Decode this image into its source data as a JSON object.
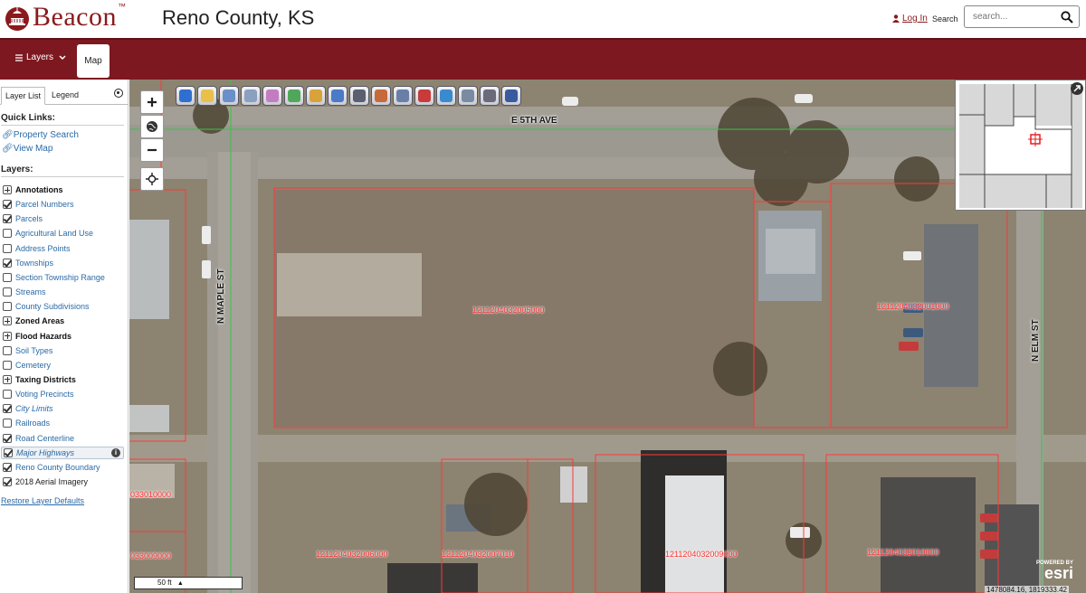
{
  "header": {
    "logo_text": "Beacon",
    "logo_tm": "™",
    "county": "Reno County, KS",
    "login_label": "Log In",
    "search_label": "Search",
    "search_placeholder": "search..."
  },
  "toolbar": {
    "layers_label": "Layers",
    "map_label": "Map"
  },
  "panel": {
    "tab_layer_list": "Layer List",
    "tab_legend": "Legend",
    "quick_links_heading": "Quick Links:",
    "quick_links": [
      "Property Search",
      "View Map"
    ],
    "layers_heading": "Layers:",
    "layers": [
      {
        "label": "Annotations",
        "state": "plus",
        "group": true
      },
      {
        "label": "Parcel Numbers",
        "state": "checked"
      },
      {
        "label": "Parcels",
        "state": "checked"
      },
      {
        "label": "Agricultural Land Use",
        "state": "unchecked"
      },
      {
        "label": "Address Points",
        "state": "unchecked"
      },
      {
        "label": "Townships",
        "state": "checked"
      },
      {
        "label": "Section Township Range",
        "state": "unchecked"
      },
      {
        "label": "Streams",
        "state": "unchecked"
      },
      {
        "label": "County Subdivisions",
        "state": "unchecked"
      },
      {
        "label": "Zoned Areas",
        "state": "plus",
        "group": true
      },
      {
        "label": "Flood Hazards",
        "state": "plus",
        "group": true
      },
      {
        "label": "Soil Types",
        "state": "unchecked"
      },
      {
        "label": "Cemetery",
        "state": "unchecked"
      },
      {
        "label": "Taxing Districts",
        "state": "plus",
        "group": true
      },
      {
        "label": "Voting Precincts",
        "state": "unchecked"
      },
      {
        "label": "City Limits",
        "state": "checked",
        "italic": true
      },
      {
        "label": "Railroads",
        "state": "unchecked"
      },
      {
        "label": "Road Centerline",
        "state": "checked"
      },
      {
        "label": "Major Highways",
        "state": "checked",
        "italic": true,
        "selected": true
      },
      {
        "label": "Reno County Boundary",
        "state": "checked"
      },
      {
        "label": "2018 Aerial Imagery",
        "state": "checked",
        "dark": true
      }
    ],
    "restore_label": "Restore Layer Defaults"
  },
  "map": {
    "street_labels": [
      "E 5TH AVE",
      "N MAPLE ST",
      "N ELM ST"
    ],
    "parcel_labels": [
      "1211204032005000",
      "1211204032001000",
      "1211204032006000",
      "1211204032007010",
      "1211204032009000",
      "1211204032010000",
      "033010000",
      "033009000"
    ],
    "scale_label": "50 ft",
    "coords": "1478084.16, 1819333.42",
    "esri_powered": "POWERED BY",
    "esri_logo": "esri",
    "tools": [
      "identify-icon",
      "select-icon",
      "zoom-select-icon",
      "pan-icon",
      "eraser-icon",
      "layer-select-icon",
      "pin-icon",
      "buffer-icon",
      "photo-icon",
      "abutters-icon",
      "magnify-icon",
      "draw-icon",
      "full-extent-icon",
      "print-icon",
      "export-icon",
      "save-icon"
    ]
  },
  "colors": {
    "brand": "#8a1a1d",
    "toolbar_bg": "#7d1820",
    "parcel_line": "#ff3030",
    "link": "#2a6aa6"
  }
}
